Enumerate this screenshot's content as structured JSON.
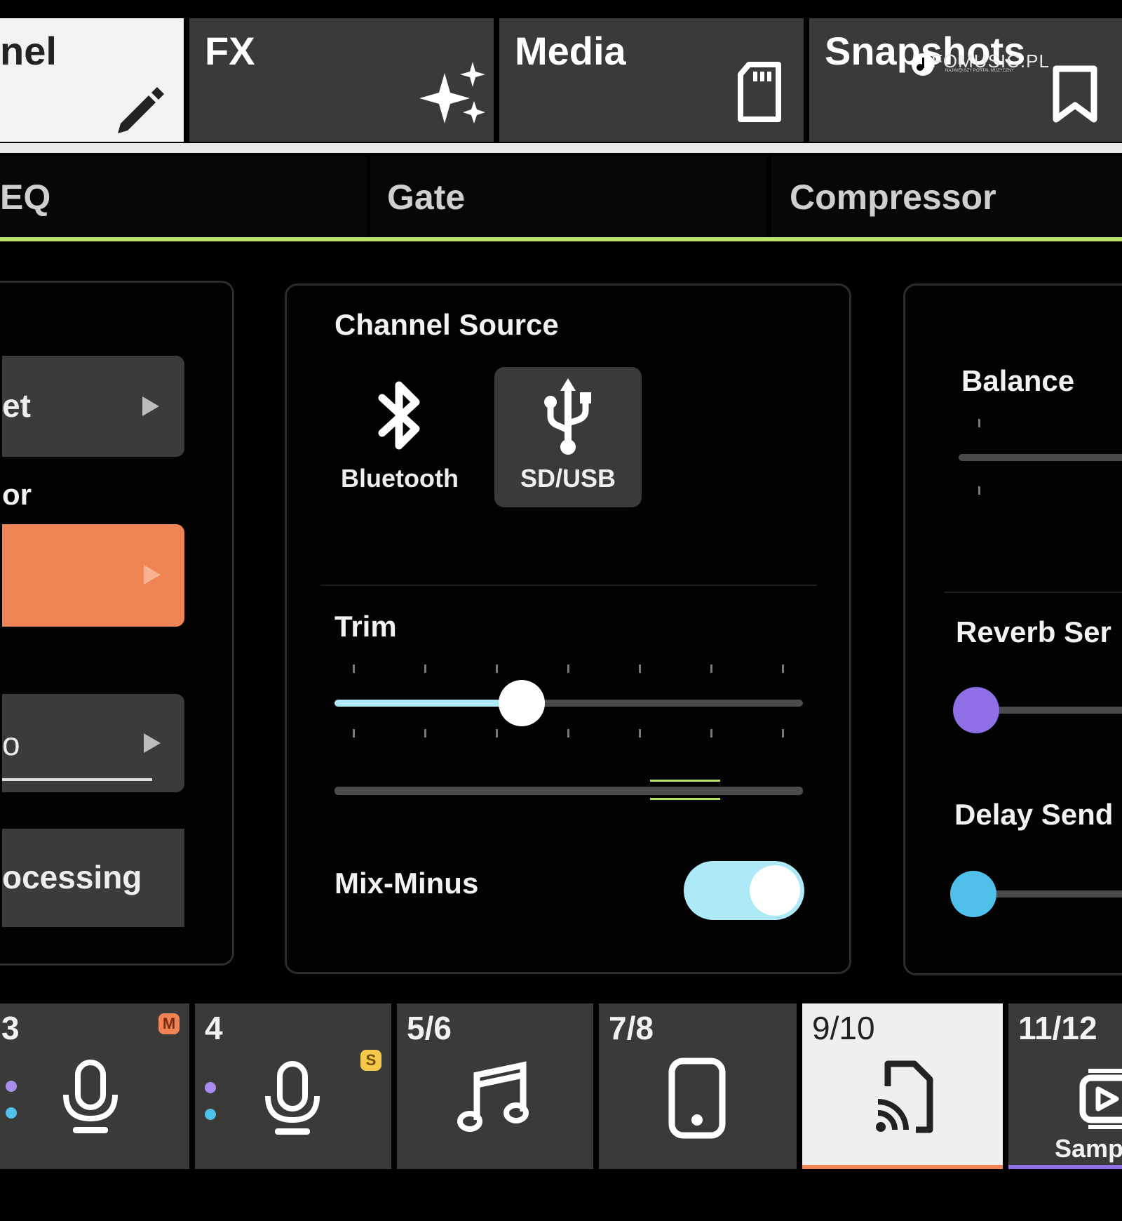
{
  "top_tabs": [
    {
      "label": "nel",
      "icon": "pencil-icon"
    },
    {
      "label": "FX",
      "icon": "sparkles-icon"
    },
    {
      "label": "Media",
      "icon": "sd-card-icon"
    },
    {
      "label": "Snapshots",
      "icon": "bookmark-icon"
    }
  ],
  "sub_tabs": [
    "EQ",
    "Gate",
    "Compressor"
  ],
  "left_panel": {
    "items": [
      "et",
      "or",
      "o",
      "ocessing"
    ]
  },
  "channel_source": {
    "title": "Channel Source",
    "options": [
      {
        "label": "Bluetooth",
        "icon": "bluetooth-icon",
        "selected": false
      },
      {
        "label": "SD/USB",
        "icon": "usb-icon",
        "selected": true
      }
    ]
  },
  "trim": {
    "label": "Trim",
    "value_fraction": 0.4
  },
  "mix_minus": {
    "label": "Mix-Minus",
    "on": true
  },
  "right_panel": {
    "balance": "Balance",
    "reverb_send": "Reverb Ser",
    "delay_send": "Delay Send"
  },
  "channels": [
    {
      "label": "3",
      "icon": "microphone-icon",
      "badge": "M"
    },
    {
      "label": "4",
      "icon": "microphone-icon",
      "badge": "S"
    },
    {
      "label": "5/6",
      "icon": "music-note-icon"
    },
    {
      "label": "7/8",
      "icon": "phone-icon"
    },
    {
      "label": "9/10",
      "icon": "cast-icon",
      "active": true
    },
    {
      "label": "11/12",
      "icon": "sampler-icon",
      "caption": "Samp"
    }
  ],
  "watermark": {
    "text": "INFOMUSIC.PL",
    "sub": "NAJWIĘKSZY PORTAL MUZYCZNY"
  },
  "colors": {
    "accent_green": "#b9e36a",
    "accent_orange": "#f08455",
    "trim_fill": "#aee9f7",
    "reverb_knob": "#8f6fe6",
    "delay_knob": "#4fc0ea",
    "badge_mute": "#f08455",
    "badge_solo": "#f5c84c"
  }
}
